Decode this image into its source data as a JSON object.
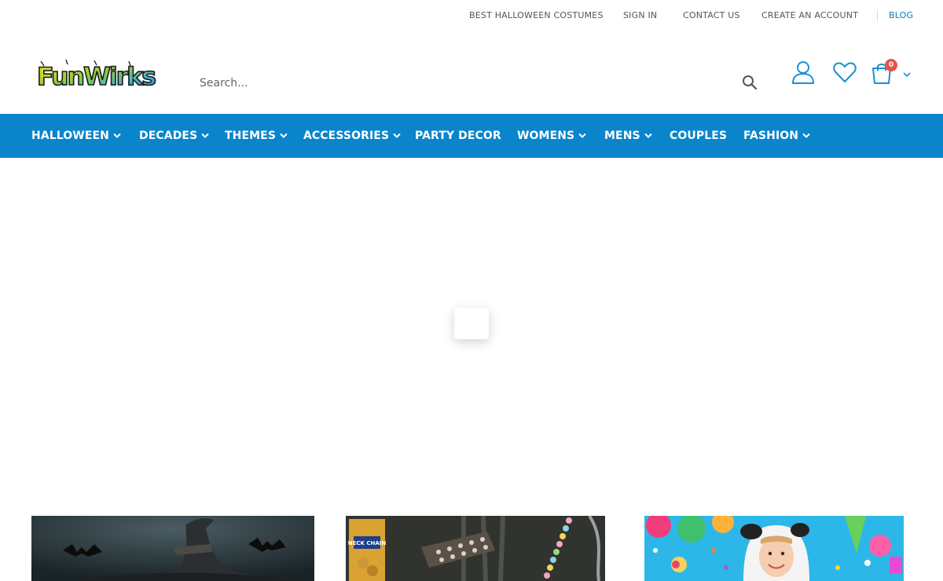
{
  "top_links": {
    "costumes": "BEST HALLOWEEN COSTUMES",
    "sign_in": "SIGN IN",
    "contact": "CONTACT US",
    "create_account": "CREATE AN ACCOUNT",
    "blog": "BLOG"
  },
  "header": {
    "logo_text": "FunWirks",
    "search_placeholder": "Search...",
    "search_icon": "search-icon",
    "user_icon": "user-icon",
    "wishlist_icon": "heart-icon",
    "cart_icon": "shopping-bag-icon",
    "cart_count": "0"
  },
  "nav": {
    "items": [
      {
        "label": "HALLOWEEN"
      },
      {
        "label": "DECADES"
      },
      {
        "label": "THEMES"
      },
      {
        "label": "ACCESSORIES"
      },
      {
        "label": "PARTY DECOR"
      },
      {
        "label": "WOMENS"
      },
      {
        "label": "MENS"
      },
      {
        "label": "COUPLES"
      },
      {
        "label": "FASHION"
      }
    ]
  },
  "banners": [
    {
      "text": ""
    },
    {
      "text": "NECK CHAIN"
    },
    {
      "text": ""
    }
  ],
  "colors": {
    "nav_bg": "#0a85cc",
    "link_blue": "#0a7ec2",
    "icon_blue": "#1a8fd4",
    "badge_red": "#e5534b"
  }
}
